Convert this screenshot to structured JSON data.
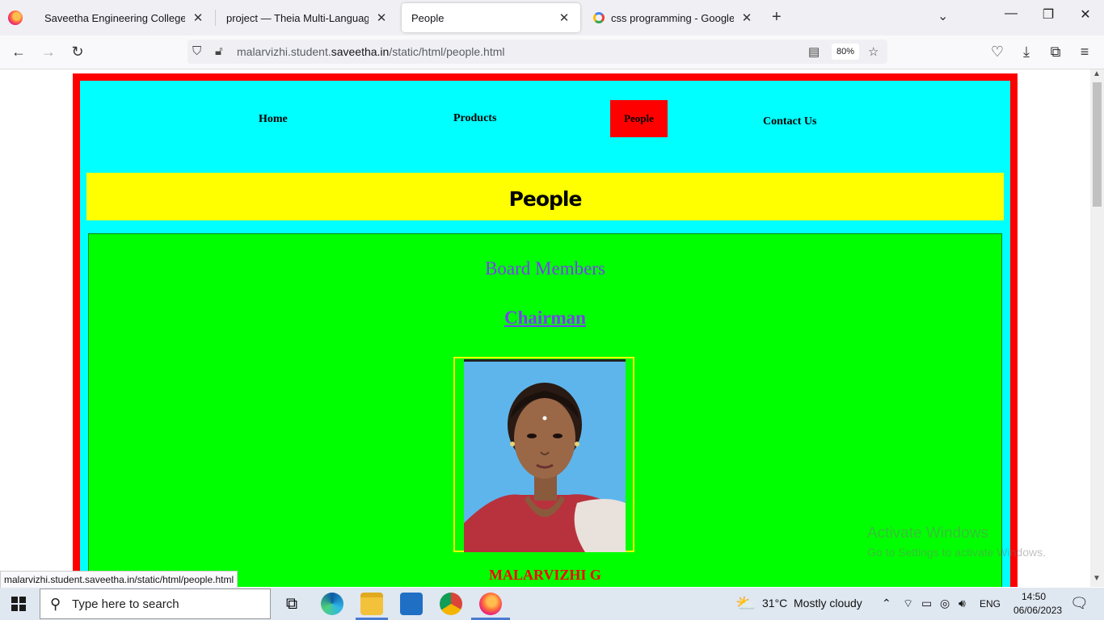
{
  "browser": {
    "tabs": [
      {
        "label": "Saveetha Engineering College"
      },
      {
        "label": "project — Theia Multi-Language Ex"
      },
      {
        "label": "People"
      },
      {
        "label": "css programming - Google Sear"
      }
    ],
    "url_prefix": "malarvizhi.student.",
    "url_domain": "saveetha.in",
    "url_path": "/static/html/people.html",
    "zoom": "80%",
    "status_link": "malarvizhi.student.saveetha.in/static/html/people.html"
  },
  "page": {
    "menu": [
      "Home",
      "Products",
      "People",
      "Contact Us"
    ],
    "active_menu": "People",
    "banner_title": "People",
    "section_heading": "Board Members",
    "role_heading": "Chairman",
    "person_name": "MALARVIZHI G",
    "colors": {
      "frame": "#ff0000",
      "background": "#00ffff",
      "banner": "#ffff00",
      "content": "#00ff00",
      "heading": "#7a3ff0",
      "name": "#ff0000"
    }
  },
  "watermark": {
    "line1": "Activate Windows",
    "line2": "Go to Settings to activate Windows."
  },
  "taskbar": {
    "search_placeholder": "Type here to search",
    "weather_temp": "31°C",
    "weather_text": "Mostly cloudy",
    "language": "ENG",
    "time": "14:50",
    "date": "06/06/2023"
  }
}
